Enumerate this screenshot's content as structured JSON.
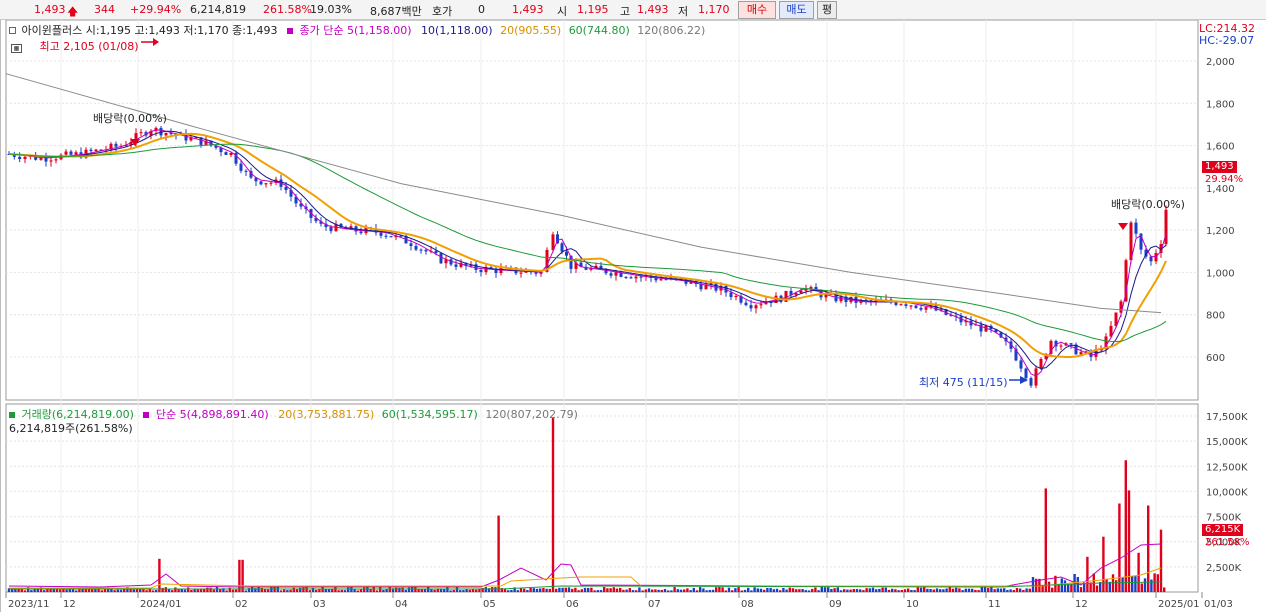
{
  "quote": {
    "price": "1,493",
    "up_arrow": "up-arrow",
    "change": "344",
    "change_pct": "+29.94%",
    "volume": "6,214,819",
    "volume_ratio": "261.58%",
    "turnover_ratio": "19.03%",
    "amount": "8,687백만",
    "hoga_label": "호가",
    "hoga_value": "0",
    "current": "1,493",
    "open_label": "시",
    "open": "1,195",
    "high_label": "고",
    "high": "1,493",
    "low_label": "저",
    "low": "1,170",
    "buy_label": "매수",
    "sell_label": "매도",
    "eval_label": "평"
  },
  "price_pane": {
    "title": "아이윈플러스 시:1,195 고:1,493 저:1,170 종:1,493",
    "ma_title": "종가 단순 5(1,158.00)",
    "ma10": "10(1,118.00)",
    "ma20": "20(905.55)",
    "ma60": "60(744.80)",
    "ma120": "120(806.22)",
    "lc": "LC:214.32",
    "hc": "HC:-29.07",
    "high_note": "최고 2,105 (01/08)",
    "low_note": "최저 475 (11/15)",
    "dividend_note_1": "배당락(0.00%)",
    "dividend_note_2": "배당락(0.00%)",
    "last_price_tag": "1,493",
    "last_pct_tag": "29.94%",
    "y_ticks": [
      "2,000",
      "1,800",
      "1,600",
      "1,400",
      "1,200",
      "1,000",
      "800",
      "600"
    ]
  },
  "volume_pane": {
    "title": "거래량(6,214,819.00)",
    "ma5": "단순 5(4,898,891.40)",
    "ma20": "20(3,753,881.75)",
    "ma60": "60(1,534,595.17)",
    "ma120": "120(807,202.79)",
    "current": "6,214,819주(261.58%)",
    "last_vol_tag": "6,215K",
    "last_pct_tag": "261.58%",
    "y_ticks": [
      "17,500K",
      "15,000K",
      "12,500K",
      "10,000K",
      "7,500K",
      "5,000K",
      "2,500K"
    ]
  },
  "x_axis": [
    "2023/11",
    "12",
    "2024/01",
    "02",
    "03",
    "04",
    "05",
    "06",
    "07",
    "08",
    "09",
    "10",
    "11",
    "12",
    "2025/01",
    "01/03"
  ],
  "colors": {
    "up": "#e0001b",
    "down": "#1a3fc7",
    "ma5": "#c000c0",
    "ma10": "#1a1a8a",
    "ma20": "#f0a000",
    "ma60": "#1e9a3a",
    "ma120": "#8a8a8a"
  }
}
